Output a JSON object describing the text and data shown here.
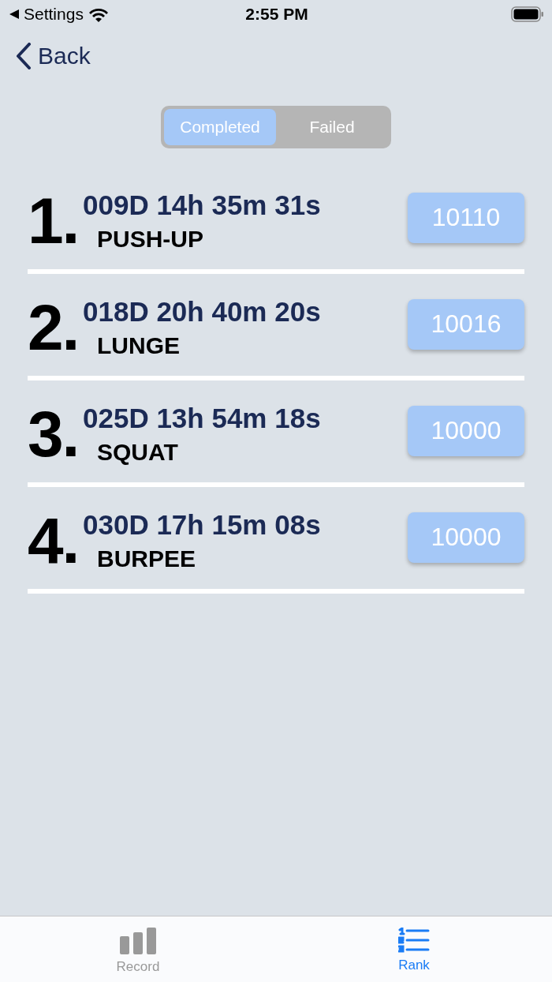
{
  "status_bar": {
    "back_app": "Settings",
    "time": "2:55 PM"
  },
  "nav": {
    "back": "Back"
  },
  "segments": [
    {
      "label": "Completed",
      "selected": true
    },
    {
      "label": "Failed",
      "selected": false
    }
  ],
  "entries": [
    {
      "rank": "1.",
      "time": "009D 14h 35m 31s",
      "exercise": "PUSH-UP",
      "score": "10110"
    },
    {
      "rank": "2.",
      "time": "018D 20h 40m 20s",
      "exercise": "LUNGE",
      "score": "10016"
    },
    {
      "rank": "3.",
      "time": "025D 13h 54m 18s",
      "exercise": "SQUAT",
      "score": "10000"
    },
    {
      "rank": "4.",
      "time": "030D 17h 15m 08s",
      "exercise": "BURPEE",
      "score": "10000"
    }
  ],
  "tab_bar": [
    {
      "label": "Record",
      "kind": "bars",
      "selected": false
    },
    {
      "label": "Rank",
      "kind": "list",
      "selected": true
    }
  ]
}
